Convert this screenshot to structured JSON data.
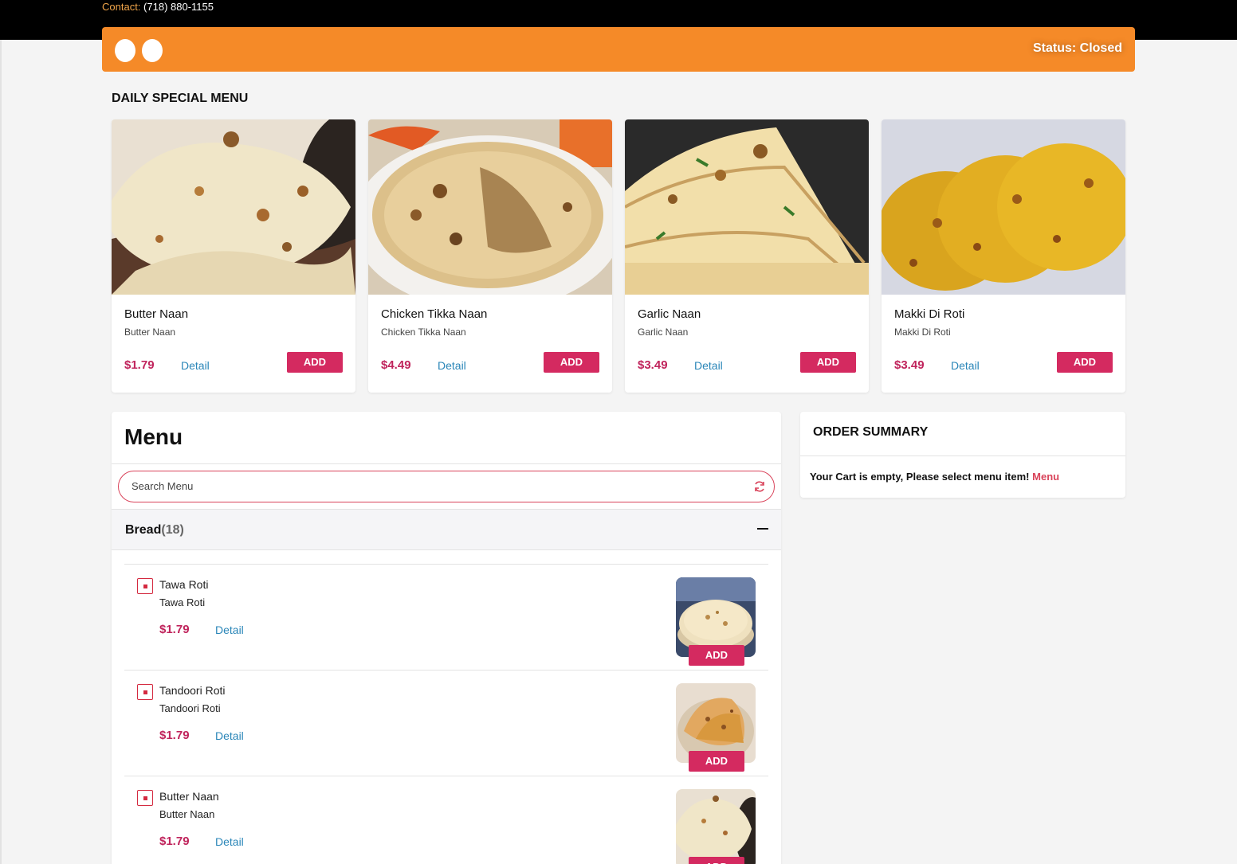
{
  "contact": {
    "label": "Contact:",
    "phone": "(718) 880-1155"
  },
  "status": "Status: Closed",
  "daily_special": {
    "title": "DAILY SPECIAL MENU",
    "items": [
      {
        "name": "Butter Naan",
        "desc": "Butter Naan",
        "price": "$1.79",
        "detail": "Detail",
        "add": "ADD"
      },
      {
        "name": "Chicken Tikka Naan",
        "desc": "Chicken Tikka Naan",
        "price": "$4.49",
        "detail": "Detail",
        "add": "ADD"
      },
      {
        "name": "Garlic Naan",
        "desc": "Garlic Naan",
        "price": "$3.49",
        "detail": "Detail",
        "add": "ADD"
      },
      {
        "name": "Makki Di Roti",
        "desc": "Makki Di Roti",
        "price": "$3.49",
        "detail": "Detail",
        "add": "ADD"
      }
    ]
  },
  "menu": {
    "title": "Menu",
    "search_placeholder": "Search Menu",
    "category": {
      "name": "Bread",
      "count": "(18)"
    },
    "items": [
      {
        "name": "Tawa Roti",
        "desc": "Tawa Roti",
        "price": "$1.79",
        "detail": "Detail",
        "add": "ADD"
      },
      {
        "name": "Tandoori Roti",
        "desc": "Tandoori Roti",
        "price": "$1.79",
        "detail": "Detail",
        "add": "ADD"
      },
      {
        "name": "Butter Naan",
        "desc": "Butter Naan",
        "price": "$1.79",
        "detail": "Detail",
        "add": "ADD"
      }
    ]
  },
  "order_summary": {
    "title": "ORDER SUMMARY",
    "empty_message": "Your Cart is empty, Please select menu item!",
    "menu_link": "Menu"
  },
  "colors": {
    "accent": "#f58a28",
    "button": "#d42a60",
    "price": "#c0245c",
    "link": "#2a86b8"
  }
}
